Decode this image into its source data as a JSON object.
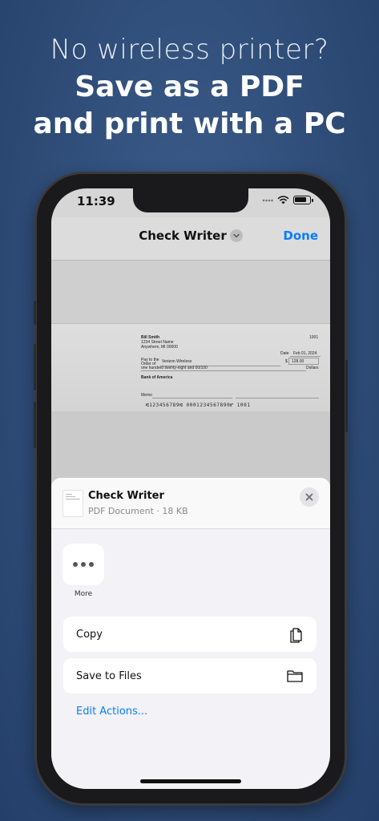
{
  "headline": {
    "line1": "No wireless printer?",
    "line2": "Save as a PDF",
    "line3": "and print with a PC"
  },
  "status_bar": {
    "time": "11:39",
    "icons": [
      "signal-dots-icon",
      "wifi-icon",
      "battery-icon"
    ],
    "battery_level": 0.85
  },
  "navbar": {
    "title": "Check Writer",
    "done_label": "Done"
  },
  "check": {
    "payer_name": "Bill Smith",
    "payer_address1": "1234 Street Name",
    "payer_address2": "Anywhere, MI 00000",
    "check_number": "1001",
    "date_label": "Date",
    "date_value": "Feb 01, 2024",
    "pay_to_label1": "Pay to the",
    "pay_to_label2": "Order of",
    "payee": "Verizon Wireless",
    "currency_symbol": "$",
    "amount": "128.00",
    "amount_words": "one hundred twenty-eight and 00/100",
    "dollars_label": "Dollars",
    "bank": "Bank of America",
    "memo_label": "Memo",
    "micr": "⑆123456789⑆ 0001234567890⑈ 1001"
  },
  "share_sheet": {
    "doc_name": "Check Writer",
    "doc_meta": "PDF Document · 18 KB",
    "more_label": "More",
    "actions": [
      {
        "label": "Copy",
        "icon": "copy-icon"
      },
      {
        "label": "Save to Files",
        "icon": "folder-icon"
      }
    ],
    "edit_actions_label": "Edit Actions..."
  },
  "colors": {
    "accent": "#0a7cff",
    "background": "#2f4d78"
  }
}
